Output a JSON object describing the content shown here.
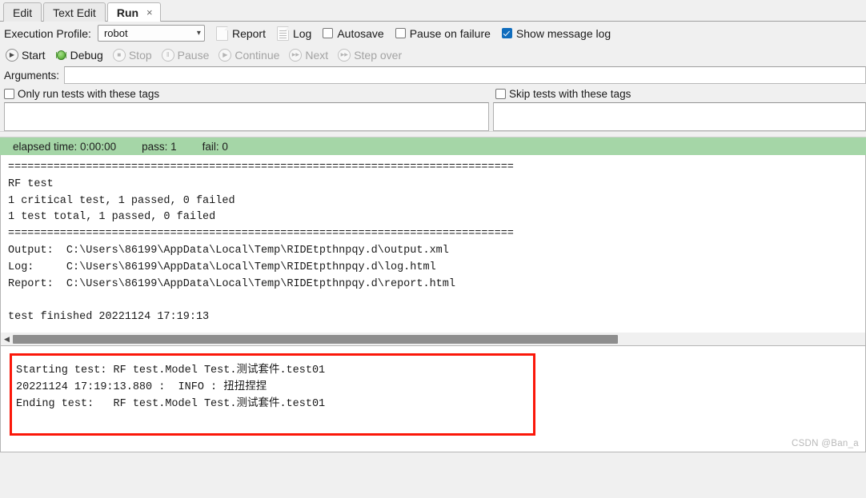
{
  "tabs": [
    {
      "label": "Edit",
      "active": false
    },
    {
      "label": "Text Edit",
      "active": false
    },
    {
      "label": "Run",
      "active": true,
      "close": "×"
    }
  ],
  "toolbar": {
    "profile_label": "Execution Profile:",
    "profile_value": "robot",
    "profile_chevron": "⌄",
    "report_label": "Report",
    "log_label": "Log",
    "autosave_label": "Autosave",
    "autosave_checked": false,
    "pause_on_failure_label": "Pause on failure",
    "pause_on_failure_checked": false,
    "show_message_log_label": "Show message log",
    "show_message_log_checked": true,
    "accent_checked_color": "#0f6cbd"
  },
  "runbar": {
    "start": "Start",
    "debug": "Debug",
    "stop": "Stop",
    "pause": "Pause",
    "continue": "Continue",
    "next": "Next",
    "step_over": "Step over",
    "glyph_start": "▶",
    "glyph_stop": "■",
    "glyph_pause": "‖",
    "glyph_continue": "▶",
    "glyph_next": "▶▶",
    "glyph_step_over": "▶▶"
  },
  "arguments": {
    "label": "Arguments:",
    "value": "",
    "placeholder": ""
  },
  "tagfilters": {
    "only_run_label": "Only run tests with these tags",
    "only_run_checked": false,
    "skip_label": "Skip tests with these tags",
    "skip_checked": false
  },
  "status": {
    "elapsed": "elapsed time: 0:00:00",
    "pass": "pass: 1",
    "fail": "fail: 0",
    "bar_color": "#a5d6a7"
  },
  "console": {
    "text": "==============================================================================\nRF test\n1 critical test, 1 passed, 0 failed\n1 test total, 1 passed, 0 failed\n==============================================================================\nOutput:  C:\\Users\\86199\\AppData\\Local\\Temp\\RIDEtpthnpqy.d\\output.xml\nLog:     C:\\Users\\86199\\AppData\\Local\\Temp\\RIDEtpthnpqy.d\\log.html\nReport:  C:\\Users\\86199\\AppData\\Local\\Temp\\RIDEtpthnpqy.d\\report.html\n\ntest finished 20221124 17:19:13"
  },
  "scrollbar": {
    "left_arrow": "◀",
    "thumb_percent": 71
  },
  "message_log": {
    "text": "Starting test: RF test.Model Test.测试套件.test01\n20221124 17:19:13.880 :  INFO : 扭扭捏捏\nEnding test:   RF test.Model Test.测试套件.test01",
    "highlight_color": "#fb1709"
  },
  "watermark": "CSDN @Ban_a"
}
